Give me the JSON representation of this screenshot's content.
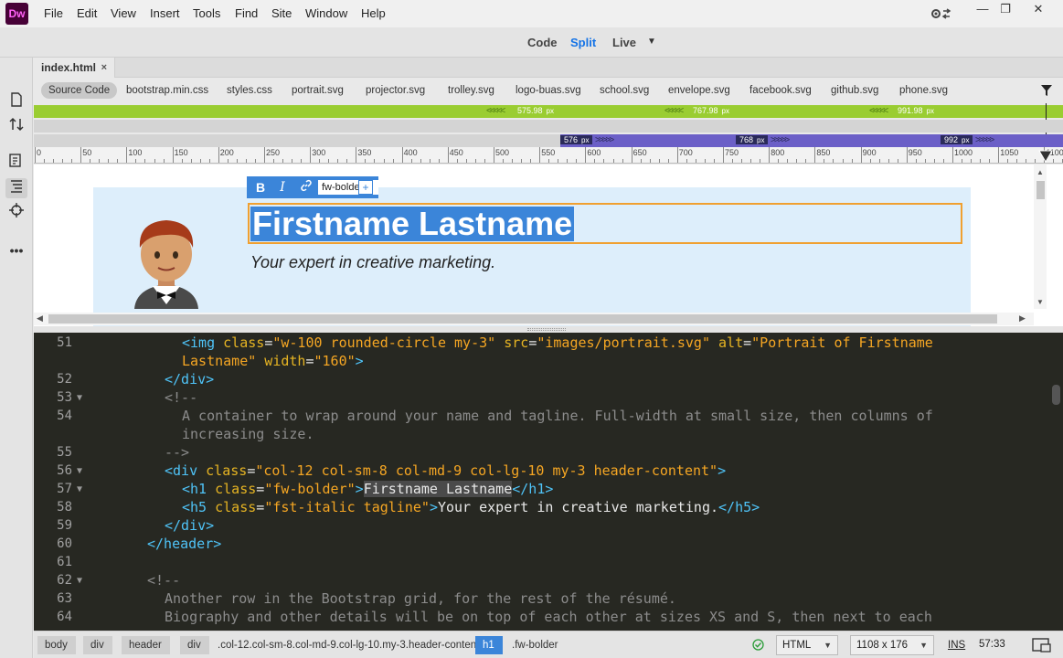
{
  "app": {
    "logo": "Dw"
  },
  "menu": [
    "File",
    "Edit",
    "View",
    "Insert",
    "Tools",
    "Find",
    "Site",
    "Window",
    "Help"
  ],
  "window_controls": {
    "minimize": "—",
    "restore": "❐",
    "close": "✕",
    "settings_icon": "gear-sync-icon"
  },
  "view_modes": {
    "code": "Code",
    "split": "Split",
    "live": "Live",
    "active": "Split",
    "active_color": "#1473e6"
  },
  "document_tab": {
    "name": "index.html",
    "close": "×"
  },
  "related_files": [
    "Source Code",
    "bootstrap.min.css",
    "styles.css",
    "portrait.svg",
    "projector.svg",
    "trolley.svg",
    "logo-buas.svg",
    "school.svg",
    "envelope.svg",
    "facebook.svg",
    "github.svg",
    "phone.svg"
  ],
  "media_queries": {
    "max_width": [
      "575.98",
      "767.98",
      "991.98"
    ],
    "min_width": [
      "576",
      "768",
      "992"
    ],
    "unit": "px",
    "max_color": "#9acd32",
    "min_color": "#6b5fc7"
  },
  "ruler": {
    "labels": [
      "0",
      "50",
      "100",
      "150",
      "200",
      "250",
      "300",
      "350",
      "400",
      "450",
      "500",
      "550",
      "600",
      "650",
      "700",
      "750",
      "800",
      "850",
      "900",
      "950",
      "1000",
      "1050",
      "1100"
    ]
  },
  "design_view": {
    "heading": "Firstname Lastname",
    "tagline": "Your expert in creative marketing.",
    "element_toolbar": {
      "bold": "B",
      "italic": "I",
      "class_name": "fw-bolder",
      "add": "+"
    },
    "background_color": "#ddeefb",
    "selection_color": "#3b85d9"
  },
  "code_lines": [
    {
      "num": "51",
      "fold": ""
    },
    {
      "num": "52",
      "fold": ""
    },
    {
      "num": "53",
      "fold": "▼"
    },
    {
      "num": "54",
      "fold": ""
    },
    {
      "num": "55",
      "fold": ""
    },
    {
      "num": "56",
      "fold": "▼"
    },
    {
      "num": "57",
      "fold": "▼"
    },
    {
      "num": "58",
      "fold": ""
    },
    {
      "num": "59",
      "fold": ""
    },
    {
      "num": "60",
      "fold": ""
    },
    {
      "num": "61",
      "fold": ""
    },
    {
      "num": "62",
      "fold": "▼"
    },
    {
      "num": "63",
      "fold": ""
    },
    {
      "num": "64",
      "fold": ""
    }
  ],
  "code": {
    "l51a": "<img ",
    "l51b": "class",
    "l51c": "=",
    "l51d": "\"w-100 rounded-circle my-3\"",
    "l51e": " src",
    "l51f": "=",
    "l51g": "\"images/portrait.svg\"",
    "l51h": " alt",
    "l51i": "=",
    "l51j": "\"Portrait of Firstname",
    "l51k": "Lastname\"",
    "l51l": " width",
    "l51m": "=",
    "l51n": "\"160\"",
    "l51o": ">",
    "l52": "</div>",
    "l53": "<!--",
    "l54a": "A container to wrap around your name and tagline. Full-width at small size, then columns of",
    "l54b": "increasing size.",
    "l55": "-->",
    "l56a": "<div ",
    "l56b": "class",
    "l56c": "=",
    "l56d": "\"col-12 col-sm-8 col-md-9 col-lg-10 my-3 header-content\"",
    "l56e": ">",
    "l57a": "<h1 ",
    "l57b": "class",
    "l57c": "=",
    "l57d": "\"fw-bolder\"",
    "l57e": ">",
    "l57f": "Firstname Lastname",
    "l57g": "</h1>",
    "l58a": "<h5 ",
    "l58b": "class",
    "l58c": "=",
    "l58d": "\"fst-italic tagline\"",
    "l58e": ">",
    "l58f": "Your expert in creative marketing.",
    "l58g": "</h5>",
    "l59": "</div>",
    "l60": "</header>",
    "l62": "<!--",
    "l63": "Another row in the Bootstrap grid, for the rest of the résumé.",
    "l64": "Biography and other details will be on top of each other at sizes XS and S, then next to each"
  },
  "status_bar": {
    "breadcrumbs": [
      "body",
      "div",
      "header",
      "div"
    ],
    "crumb_class": ".col-12.col-sm-8.col-md-9.col-lg-10.my-3.header-content",
    "active_tag": "h1",
    "active_class": ".fw-bolder",
    "language": "HTML",
    "window_size": "1108 x 176",
    "insert_mode": "INS",
    "cursor": "57:33",
    "status_icon": "check-circle-icon",
    "live_preview_icon": "preview-icon"
  }
}
